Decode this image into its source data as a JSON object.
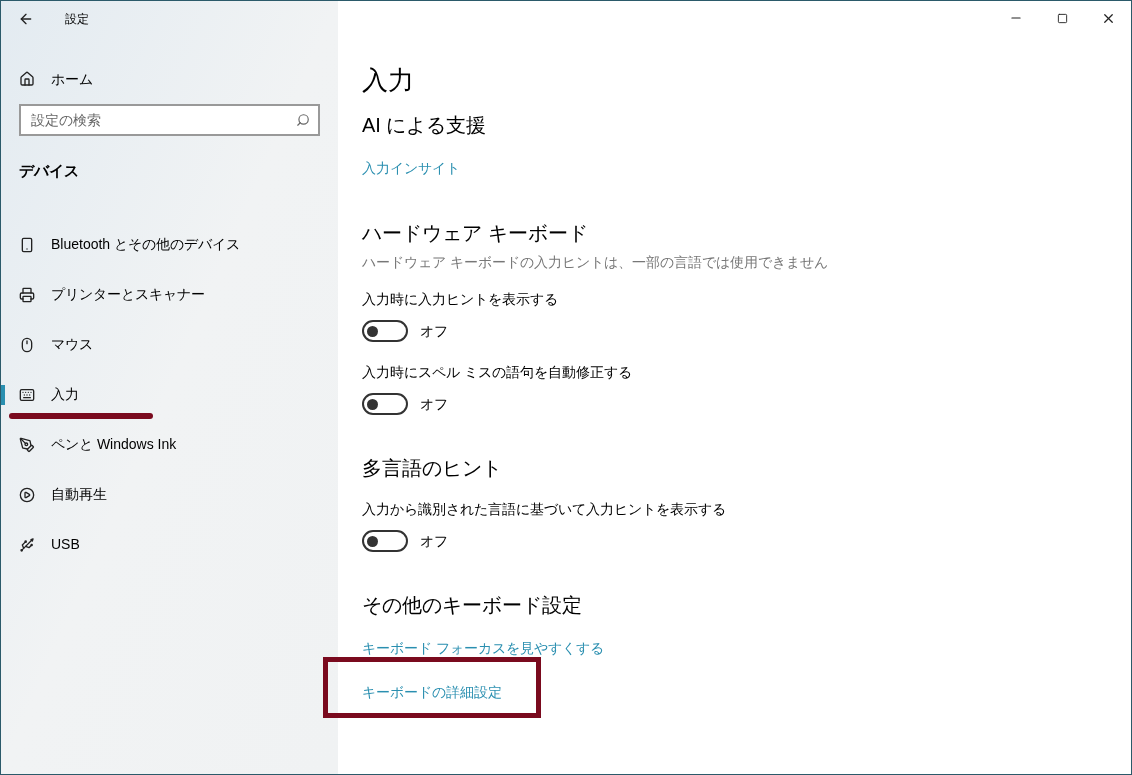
{
  "window": {
    "title": "設定"
  },
  "sidebar": {
    "home": "ホーム",
    "search": {
      "placeholder": "設定の検索"
    },
    "section": "デバイス",
    "items": [
      {
        "label": "Bluetooth とその他のデバイス",
        "selected": false,
        "highlighted": false
      },
      {
        "label": "プリンターとスキャナー",
        "selected": false,
        "highlighted": false
      },
      {
        "label": "マウス",
        "selected": false,
        "highlighted": false
      },
      {
        "label": "入力",
        "selected": true,
        "highlighted": true
      },
      {
        "label": "ペンと Windows Ink",
        "selected": false,
        "highlighted": false
      },
      {
        "label": "自動再生",
        "selected": false,
        "highlighted": false
      },
      {
        "label": "USB",
        "selected": false,
        "highlighted": false
      }
    ]
  },
  "page_title": "入力",
  "sections": [
    {
      "heading": "AI による支援",
      "items": [
        {
          "kind": "link",
          "text": "入力インサイト",
          "highlighted": false
        }
      ]
    },
    {
      "heading": "ハードウェア キーボード",
      "description": "ハードウェア キーボードの入力ヒントは、一部の言語では使用できません",
      "items": [
        {
          "kind": "toggle",
          "label": "入力時に入力ヒントを表示する",
          "on": false,
          "state_text": "オフ"
        },
        {
          "kind": "toggle",
          "label": "入力時にスペル ミスの語句を自動修正する",
          "on": false,
          "state_text": "オフ"
        }
      ]
    },
    {
      "heading": "多言語のヒント",
      "items": [
        {
          "kind": "toggle",
          "label": "入力から識別された言語に基づいて入力ヒントを表示する",
          "on": false,
          "state_text": "オフ"
        }
      ]
    },
    {
      "heading": "その他のキーボード設定",
      "items": [
        {
          "kind": "link",
          "text": "キーボード フォーカスを見やすくする",
          "highlighted": false
        },
        {
          "kind": "link",
          "text": "キーボードの詳細設定",
          "highlighted": true
        }
      ]
    }
  ]
}
